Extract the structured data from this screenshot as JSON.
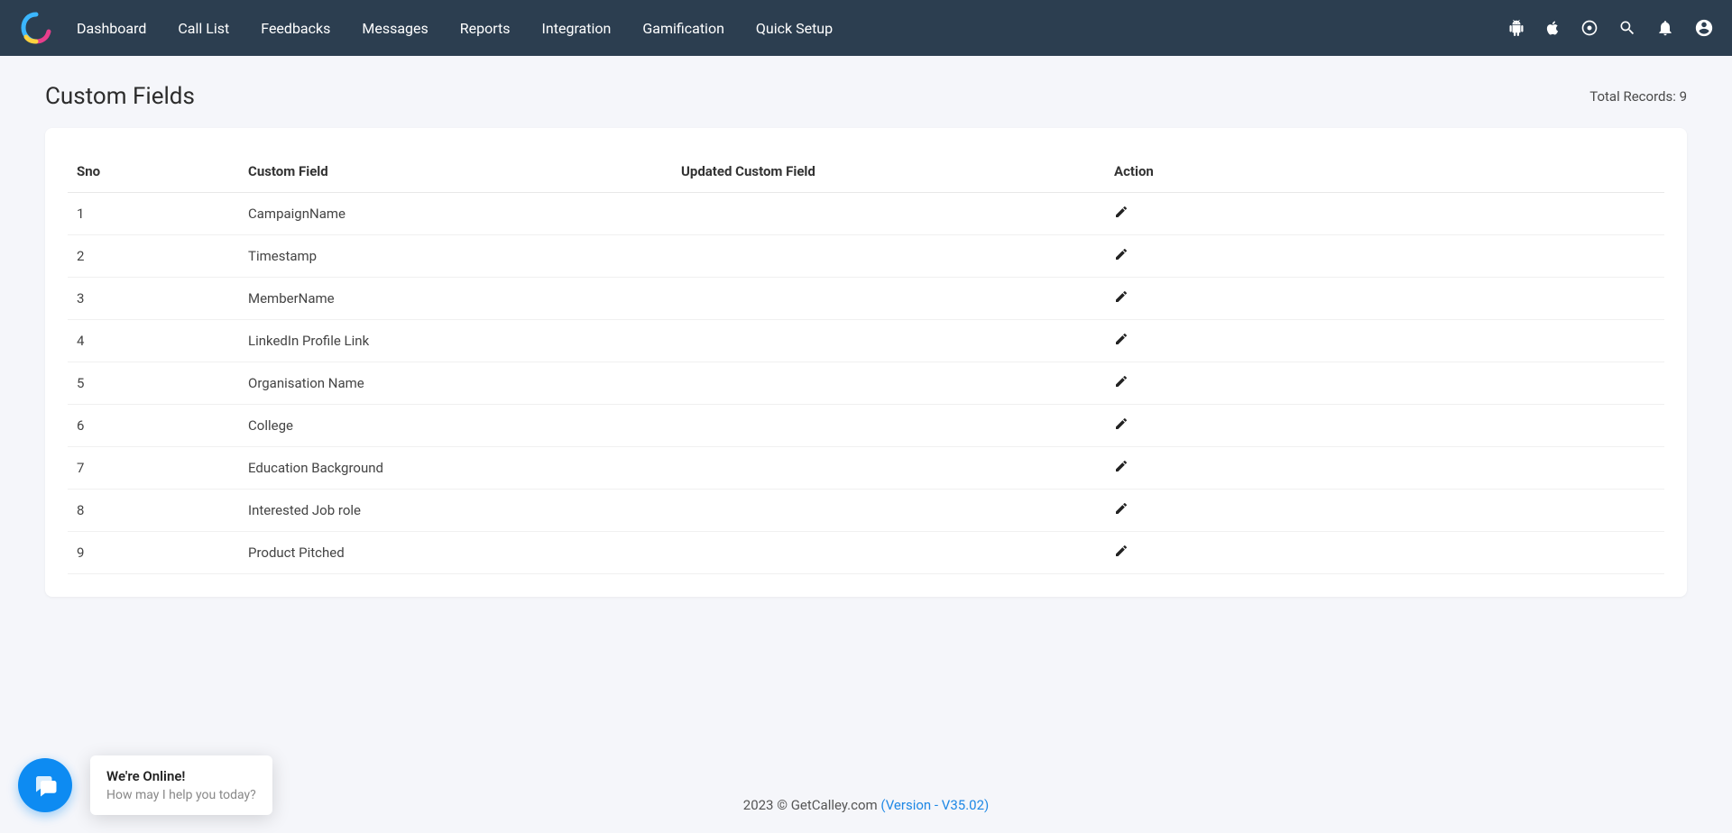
{
  "nav": {
    "items": [
      "Dashboard",
      "Call List",
      "Feedbacks",
      "Messages",
      "Reports",
      "Integration",
      "Gamification",
      "Quick Setup"
    ]
  },
  "page": {
    "title": "Custom Fields",
    "total_records_label": "Total Records: 9"
  },
  "table": {
    "headers": {
      "sno": "Sno",
      "custom_field": "Custom Field",
      "updated": "Updated Custom Field",
      "action": "Action"
    },
    "rows": [
      {
        "sno": "1",
        "name": "CampaignName",
        "updated": ""
      },
      {
        "sno": "2",
        "name": "Timestamp",
        "updated": ""
      },
      {
        "sno": "3",
        "name": "MemberName",
        "updated": ""
      },
      {
        "sno": "4",
        "name": "LinkedIn Profile Link",
        "updated": ""
      },
      {
        "sno": "5",
        "name": "Organisation Name",
        "updated": ""
      },
      {
        "sno": "6",
        "name": "College",
        "updated": ""
      },
      {
        "sno": "7",
        "name": "Education Background",
        "updated": ""
      },
      {
        "sno": "8",
        "name": "Interested Job role",
        "updated": ""
      },
      {
        "sno": "9",
        "name": "Product Pitched",
        "updated": ""
      }
    ]
  },
  "chat": {
    "title": "We're Online!",
    "subtitle": "How may I help you today?"
  },
  "footer": {
    "copyright": "2023 © GetCalley.com ",
    "version": "(Version - V35.02)"
  }
}
